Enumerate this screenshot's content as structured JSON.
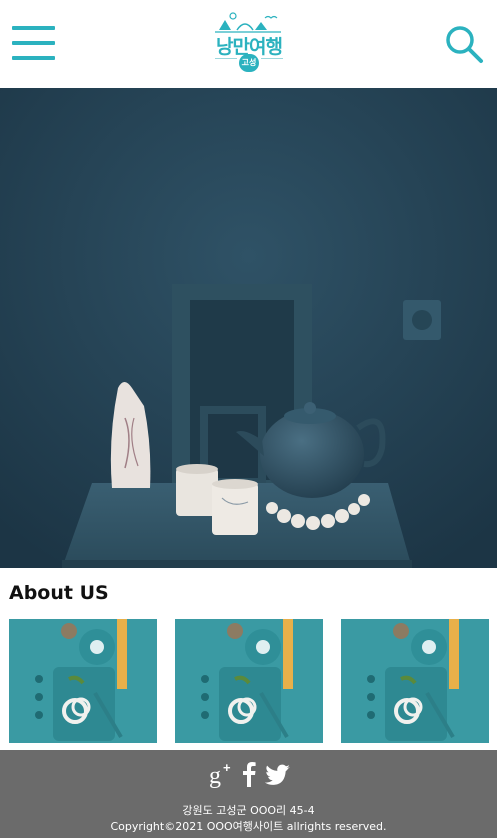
{
  "header": {
    "logo_text": "낭만여행",
    "logo_badge": "고성",
    "menu_icon": "hamburger-menu-icon",
    "search_icon": "search-icon"
  },
  "hero": {
    "image": "still-life-teapot-frame-photo"
  },
  "about": {
    "title": "About US",
    "thumbnails": [
      {
        "image": "food-plate-photo"
      },
      {
        "image": "food-plate-photo"
      },
      {
        "image": "food-plate-photo"
      }
    ]
  },
  "footer": {
    "social": [
      "google-plus-icon",
      "facebook-icon",
      "twitter-icon"
    ],
    "address": "강원도 고성군 OOO리 45-4",
    "copyright": "Copyright©2021 OOO여행사이트 allrights reserved."
  },
  "colors": {
    "brand": "#2bb2bf",
    "footer_bg": "#6b6b6b",
    "hero_wall": "#2a4a5c",
    "thumb_bg": "#3a9aa3"
  }
}
